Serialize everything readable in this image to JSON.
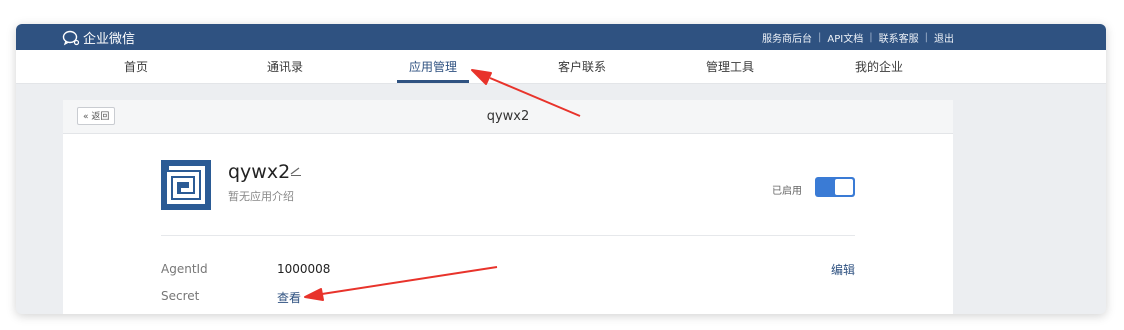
{
  "topbar": {
    "brand": "企业微信",
    "links": [
      "服务商后台",
      "API文档",
      "联系客服",
      "退出"
    ]
  },
  "nav": {
    "items": [
      "首页",
      "通讯录",
      "应用管理",
      "客户联系",
      "管理工具",
      "我的企业"
    ],
    "active_index": 2
  },
  "panel": {
    "back_label": "« 返回",
    "title": "qywx2"
  },
  "app": {
    "name": "qywx2",
    "description": "暂无应用介绍",
    "status_label": "已启用",
    "enabled": true
  },
  "fields": {
    "agentid_label": "AgentId",
    "agentid_value": "1000008",
    "secret_label": "Secret",
    "secret_action": "查看",
    "edit_label": "编辑"
  },
  "colors": {
    "topbar": "#2f5281",
    "accent": "#3a7bd5",
    "annotation_arrow": "#e8332b"
  }
}
